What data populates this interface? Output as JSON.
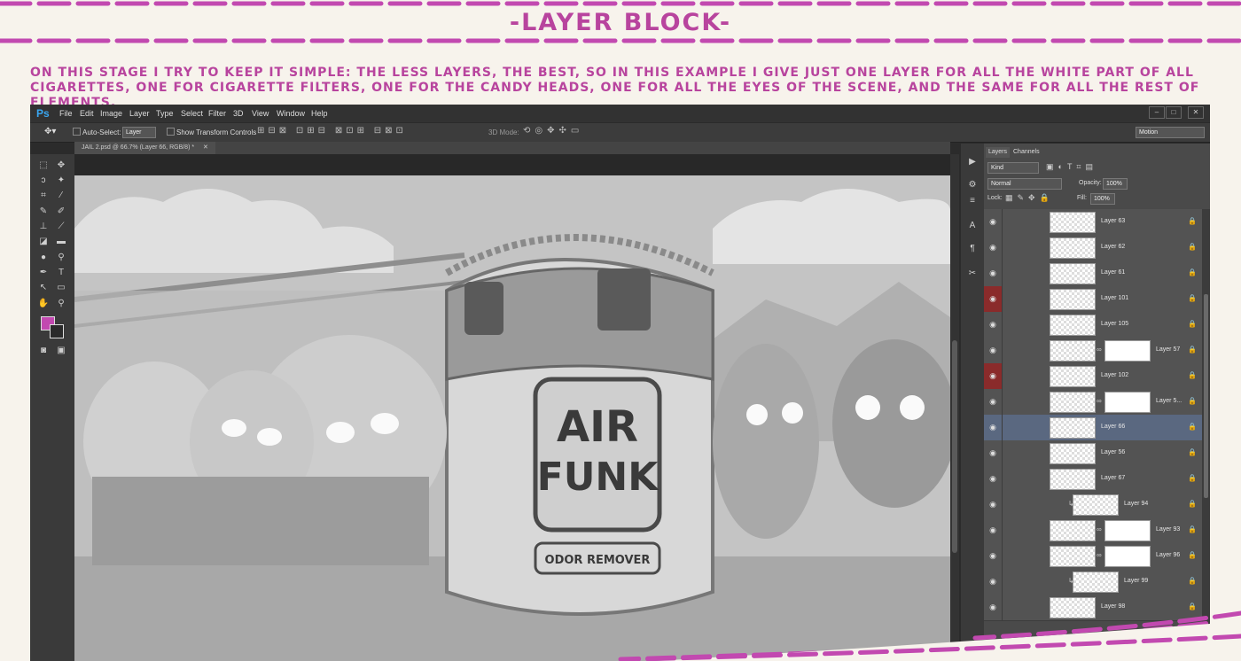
{
  "header": {
    "title": "-LAYER BLOCK-",
    "description": "On this stage I try to keep it simple: the less layers, the best, so in this example I give just one layer for all the white part of all cigarettes, one for cigarette filters, one for the candy heads, one for all the eyes of the scene, and the same for all the rest of elements."
  },
  "accent_color": "#c249b0",
  "photoshop": {
    "app_logo": "Ps",
    "menu": [
      "File",
      "Edit",
      "Image",
      "Layer",
      "Type",
      "Select",
      "Filter",
      "3D",
      "View",
      "Window",
      "Help"
    ],
    "window_controls": [
      "minimize-icon",
      "maximize-icon",
      "close-icon"
    ],
    "options_bar": {
      "auto_select_label": "Auto-Select:",
      "auto_select_value": "Layer",
      "show_transform_label": "Show Transform Controls",
      "mode_3d_label": "3D Mode:",
      "workspace": "Motion"
    },
    "document_tab": "JAIL 2.psd @ 66.7% (Layer 66, RGB/8) *",
    "artwork": {
      "sign_line1": "AIR",
      "sign_line2": "FUNK",
      "sign_sub": "ODOR REMOVER"
    },
    "layers_panel": {
      "tabs": [
        "Layers",
        "Channels"
      ],
      "kind_filter": "Kind",
      "blend_mode": "Normal",
      "opacity_label": "Opacity:",
      "opacity_value": "100%",
      "lock_label": "Lock:",
      "fill_label": "Fill:",
      "fill_value": "100%",
      "layers": [
        {
          "name": "Layer 63",
          "mask": false,
          "clipped": false,
          "selected": false,
          "red": false
        },
        {
          "name": "Layer 62",
          "mask": false,
          "clipped": false,
          "selected": false,
          "red": false
        },
        {
          "name": "Layer 61",
          "mask": false,
          "clipped": false,
          "selected": false,
          "red": false
        },
        {
          "name": "Layer 101",
          "mask": false,
          "clipped": false,
          "selected": false,
          "red": true
        },
        {
          "name": "Layer 105",
          "mask": false,
          "clipped": false,
          "selected": false,
          "red": false
        },
        {
          "name": "Layer 57",
          "mask": true,
          "clipped": false,
          "selected": false,
          "red": false
        },
        {
          "name": "Layer 102",
          "mask": false,
          "clipped": false,
          "selected": false,
          "red": true
        },
        {
          "name": "Layer 5...",
          "mask": true,
          "clipped": false,
          "selected": false,
          "red": false
        },
        {
          "name": "Layer 66",
          "mask": false,
          "clipped": false,
          "selected": true,
          "red": false
        },
        {
          "name": "Layer 56",
          "mask": false,
          "clipped": false,
          "selected": false,
          "red": false
        },
        {
          "name": "Layer 67",
          "mask": false,
          "clipped": false,
          "selected": false,
          "red": false
        },
        {
          "name": "Layer 94",
          "mask": false,
          "clipped": true,
          "selected": false,
          "red": false
        },
        {
          "name": "Layer 93",
          "mask": true,
          "clipped": false,
          "selected": false,
          "red": false
        },
        {
          "name": "Layer 96",
          "mask": true,
          "clipped": false,
          "selected": false,
          "red": false
        },
        {
          "name": "Layer 99",
          "mask": false,
          "clipped": true,
          "selected": false,
          "red": false
        },
        {
          "name": "Layer 98",
          "mask": false,
          "clipped": false,
          "selected": false,
          "red": false
        }
      ]
    }
  }
}
